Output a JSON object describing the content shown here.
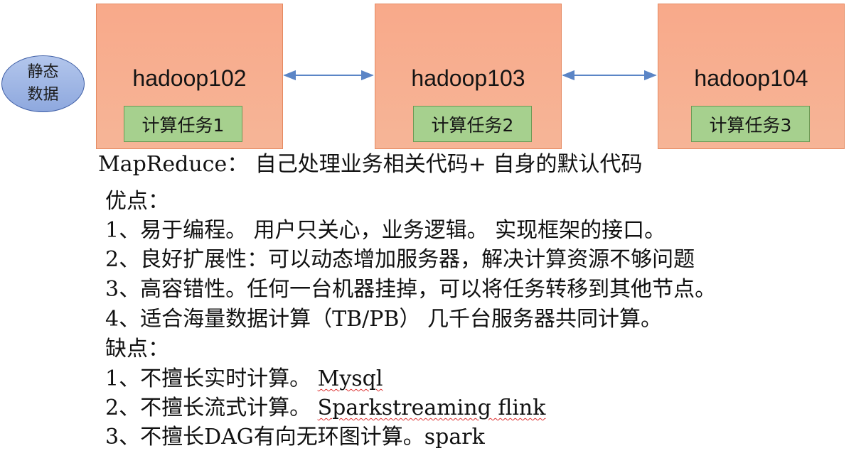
{
  "diagram": {
    "source": {
      "label": "静态\n数据"
    },
    "nodes": [
      {
        "title": "hadoop102",
        "task": "计算任务1"
      },
      {
        "title": "hadoop103",
        "task": "计算任务2"
      },
      {
        "title": "hadoop104",
        "task": "计算任务3"
      }
    ],
    "colors": {
      "node_fill": "#f8a98a",
      "node_border": "#e58960",
      "task_fill": "#a6d08e",
      "arrow": "#5b85c6",
      "oval_fill": "#a3b9e6"
    }
  },
  "notes": {
    "intro": "MapReduce： 自己处理业务相关代码+ 自身的默认代码",
    "pros_heading": "优点：",
    "pros": [
      "1、易于编程。 用户只关心，业务逻辑。 实现框架的接口。",
      "2、良好扩展性：可以动态增加服务器，解决计算资源不够问题",
      "3、高容错性。任何一台机器挂掉，可以将任务转移到其他节点。",
      "4、适合海量数据计算（TB/PB） 几千台服务器共同计算。"
    ],
    "cons_heading": "缺点：",
    "cons": [
      {
        "prefix": "1、不擅长实时计算。 ",
        "term": "Mysql"
      },
      {
        "prefix": "2、不擅长流式计算。 ",
        "term": "Sparkstreaming flink"
      },
      {
        "prefix": "3、不擅长DAG有向无环图计算。",
        "term": "spark"
      }
    ]
  }
}
